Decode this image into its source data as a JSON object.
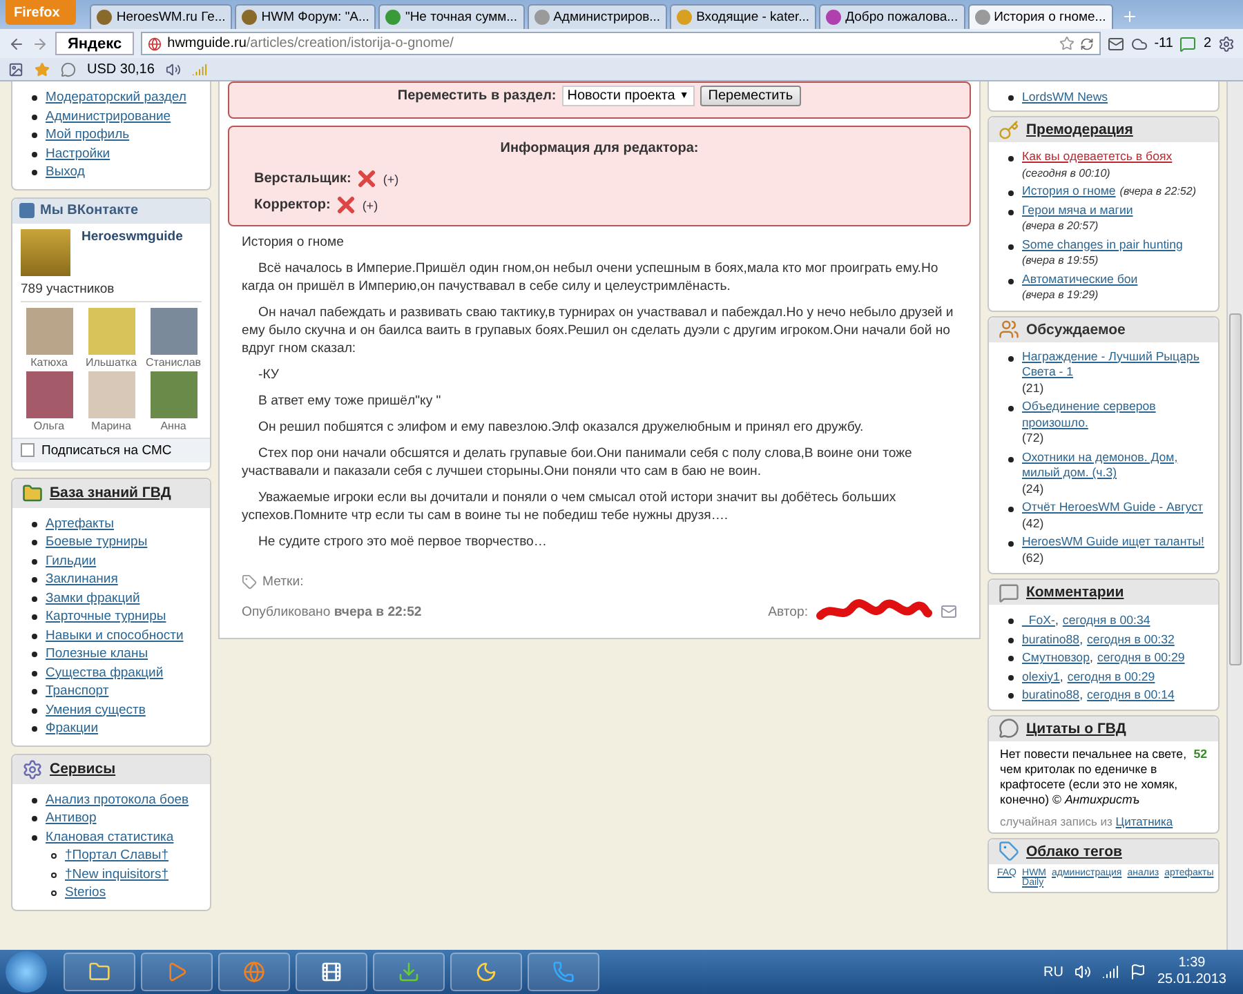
{
  "browser": {
    "menu_button": "Firefox",
    "tabs": [
      {
        "label": "HeroesWM.ru Ге...",
        "selected": false,
        "color": "#8a6a2a"
      },
      {
        "label": "HWM Форум: \"А...",
        "selected": false,
        "color": "#8a6a2a"
      },
      {
        "label": "\"Не точная сумм...",
        "selected": false,
        "color": "#3a9a3a"
      },
      {
        "label": "Администриров...",
        "selected": false,
        "color": "#9a9a9a"
      },
      {
        "label": "Входящие - kater...",
        "selected": false,
        "color": "#d8a020"
      },
      {
        "label": "Добро пожалова...",
        "selected": false,
        "color": "#b040b0"
      },
      {
        "label": "История о гноме...",
        "selected": true,
        "color": "#9a9a9a"
      }
    ],
    "search_logo": "Яндекс",
    "address_host": "hwmguide.ru",
    "address_path": "/articles/creation/istorija-o-gnome/",
    "weather": "-11",
    "messages": "2",
    "currency": "USD 30,16"
  },
  "left": {
    "menu": [
      "Модераторский раздел",
      "Администрирование",
      "Мой профиль",
      "Настройки",
      "Выход"
    ],
    "vk": {
      "title": "Мы ВКонтакте",
      "group": "Heroeswmguide",
      "members": "789 участников",
      "people": [
        "Катюха",
        "Ильшатка",
        "Станислав",
        "Ольга",
        "Марина",
        "Анна"
      ],
      "subscribe": {
        "label": "Подписаться на СМС",
        "checked": false
      }
    },
    "knowledge": {
      "title": "База знаний ГВД",
      "items": [
        "Артефакты",
        "Боевые турниры",
        "Гильдии",
        "Заклинания",
        "Замки фракций",
        "Карточные турниры",
        "Навыки и способности",
        "Полезные кланы",
        "Существа фракций",
        "Транспорт",
        "Умения существ",
        "Фракции"
      ]
    },
    "services": {
      "title": "Сервисы",
      "items": [
        {
          "label": "Анализ протокола боев"
        },
        {
          "label": "Антивор"
        },
        {
          "label": "Клановая статистика",
          "children": [
            {
              "label": "†Портал Славы†"
            },
            {
              "label": "†New inquisitors†"
            },
            {
              "label": "Sterios"
            }
          ]
        }
      ]
    }
  },
  "center": {
    "move": {
      "label": "Переместить в раздел:",
      "section": "Новости проекта",
      "caret": "▼",
      "button": "Переместить"
    },
    "editor": {
      "title": "Информация для редактора:",
      "roles": [
        "Верстальщик:",
        "Корректор:"
      ],
      "add": "(+)"
    },
    "article": {
      "title": "История о гноме",
      "paragraphs": [
        "Всё началось в Империе.Пришёл один гном,он небыл очени успешным в боях,мала кто мог проиграть ему.Но кагда он пришёл в Империю,он пачуствавал в себе силу и целеустримлёнасть.",
        "Он начал пабеждать и развивать сваю тактику,в турнирах он участвавал и пабеждал.Но у нечо небыло друзей и ему было скучна и он баилса ваить в групавых боях.Решил он сделать дуэли с другим игроком.Они начали бой но вдруг гном сказал:",
        "-КУ",
        "В атвет ему тоже пришёл\"ку \"",
        "Он решил побшятся с элифом и ему павезлою.Элф оказался дружелюбным и принял его дружбу.",
        "Стех пор они начали обсшятся и делать групавые бои.Они панимали себя с полу слова,В воине они тоже участвавали и паказали себя с лучшеи сторыны.Они поняли что сам в баю не воин.",
        "Уважаемые игроки если вы дочитали и поняли о чем смысал отой истори значит вы добётесь больших успехов.Помните чтр если ты сам в воине ты не победиш тебе нужны друзя….",
        "Не судите строго это моё первое творчество…"
      ],
      "tags_label": "Метки:",
      "published": "Опубликовано **вчера в 22:52**",
      "author_label": "Автор:"
    }
  },
  "right": {
    "top_link": "LordsWM News",
    "premoderation": {
      "title": "Премодерация",
      "items": [
        {
          "title": "Как вы одеваететсь в боях",
          "date": "(сегодня в 00:10)",
          "highlighted": true
        },
        {
          "title": "История о гноме",
          "date": "(вчера в 22:52)",
          "highlighted": false
        },
        {
          "title": "Герои мяча и магии",
          "date": "(вчера в 20:57)",
          "highlighted": false
        },
        {
          "title": "Some changes in pair hunting",
          "date": "(вчера в 19:55)",
          "highlighted": false
        },
        {
          "title": "Автоматические бои",
          "date": "(вчера в 19:29)",
          "highlighted": false
        }
      ]
    },
    "discussed": {
      "title": "Обсуждаемое",
      "items": [
        {
          "title": "Награждение - Лучший Рыцарь Света - 1",
          "count": "(21)"
        },
        {
          "title": "Объединение серверов произошло.",
          "count": "(72)"
        },
        {
          "title": "Охотники на демонов. Дом, милый дом. (ч.3)",
          "count": "(24)"
        },
        {
          "title": "Отчёт HeroesWM Guide - Август",
          "count": "(42)"
        },
        {
          "title": "HeroesWM Guide ищет таланты!",
          "count": "(62)"
        }
      ]
    },
    "comments": {
      "title": "Комментарии",
      "separator": ",",
      "items": [
        {
          "user": "_FoX-",
          "time": "сегодня в 00:34"
        },
        {
          "user": "buratino88",
          "time": "сегодня в 00:32"
        },
        {
          "user": "Смутновзор",
          "time": "сегодня в 00:29"
        },
        {
          "user": "olexiy1",
          "time": "сегодня в 00:29"
        },
        {
          "user": "buratino88",
          "time": "сегодня в 00:14"
        }
      ]
    },
    "quotes": {
      "title": "Цитаты о ГВД",
      "text": "Нет повести печальнее на свете, чем критолак по еденичке в крафтосете (если это не хомяк, конечно) © *Антихристъ*",
      "score": "52",
      "footer": "случайная запись из",
      "link": "Цитатника"
    },
    "tag_cloud": {
      "title": "Облако тегов",
      "tags": [
        "FAQ",
        "HWM Daily",
        "администрация",
        "анализ",
        "артефакты"
      ]
    }
  },
  "taskbar": {
    "language": "RU",
    "time": "1:39",
    "date": "25.01.2013"
  }
}
